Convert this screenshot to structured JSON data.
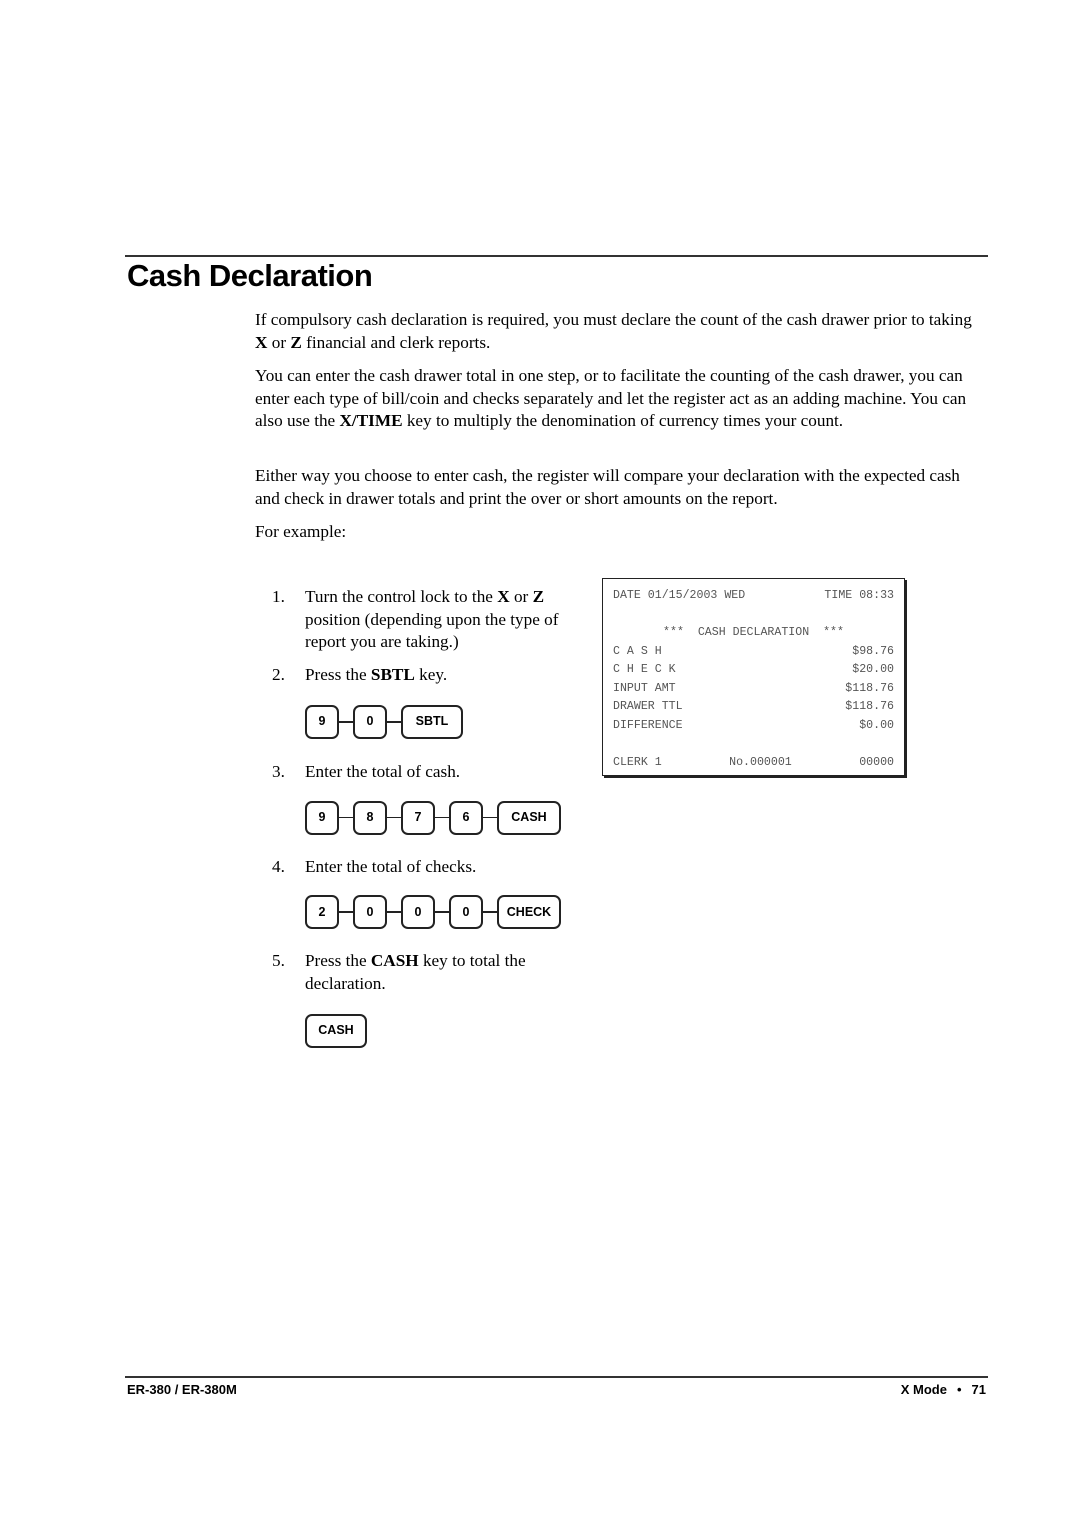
{
  "title": "Cash Declaration",
  "paragraphs": {
    "p1_a": "If compulsory cash declaration is required, you must declare the count of the cash drawer prior to taking ",
    "p1_b1": "X",
    "p1_c": " or ",
    "p1_b2": "Z",
    "p1_d": " financial and clerk reports.",
    "p2_a": "You can enter the cash drawer total in one step, or to facilitate the counting of the cash drawer, you can enter each type of bill/coin and checks separately and let the register act as an adding machine.   You can also use the ",
    "p2_b": "X/TIME",
    "p2_c": " key to multiply the denomination of currency times your count.",
    "p3": "Either way you choose to enter cash, the register will compare your declaration with the expected cash and check in drawer totals and print the over or short amounts on the report.",
    "p4": "For example:"
  },
  "steps": [
    {
      "num": "1.",
      "a": "Turn the control lock to the ",
      "b1": "X",
      "c": " or ",
      "b2": "Z",
      "d": " position (depending upon the type of report you are taking.)"
    },
    {
      "num": "2.",
      "a": "Press the ",
      "b": "SBTL",
      "c": " key.",
      "keys": [
        "9",
        "0",
        "SBTL"
      ]
    },
    {
      "num": "3.",
      "a": "Enter the total of cash.",
      "keys": [
        "9",
        "8",
        "7",
        "6",
        "CASH"
      ]
    },
    {
      "num": "4.",
      "a": "Enter the total of checks.",
      "keys": [
        "2",
        "0",
        "0",
        "0",
        "CHECK"
      ]
    },
    {
      "num": "5.",
      "a": "Press the ",
      "b": "CASH",
      "c": " key to total the declaration.",
      "keys": [
        "CASH"
      ]
    }
  ],
  "receipt": {
    "date": "DATE 01/15/2003 WED",
    "time": "TIME 08:33",
    "heading": "***  CASH DECLARATION  ***",
    "rows": [
      {
        "label": "C A S H",
        "value": "$98.76"
      },
      {
        "label": "C H E C K",
        "value": "$20.00"
      },
      {
        "label": "INPUT AMT",
        "value": "$118.76"
      },
      {
        "label": "DRAWER TTL",
        "value": "$118.76"
      },
      {
        "label": "DIFFERENCE",
        "value": "$0.00"
      }
    ],
    "clerk": "CLERK 1",
    "number": "No.000001",
    "code": "00000"
  },
  "footer": {
    "model": "ER-380 / ER-380M",
    "section": "X Mode",
    "bullet": "•",
    "page": "71"
  }
}
